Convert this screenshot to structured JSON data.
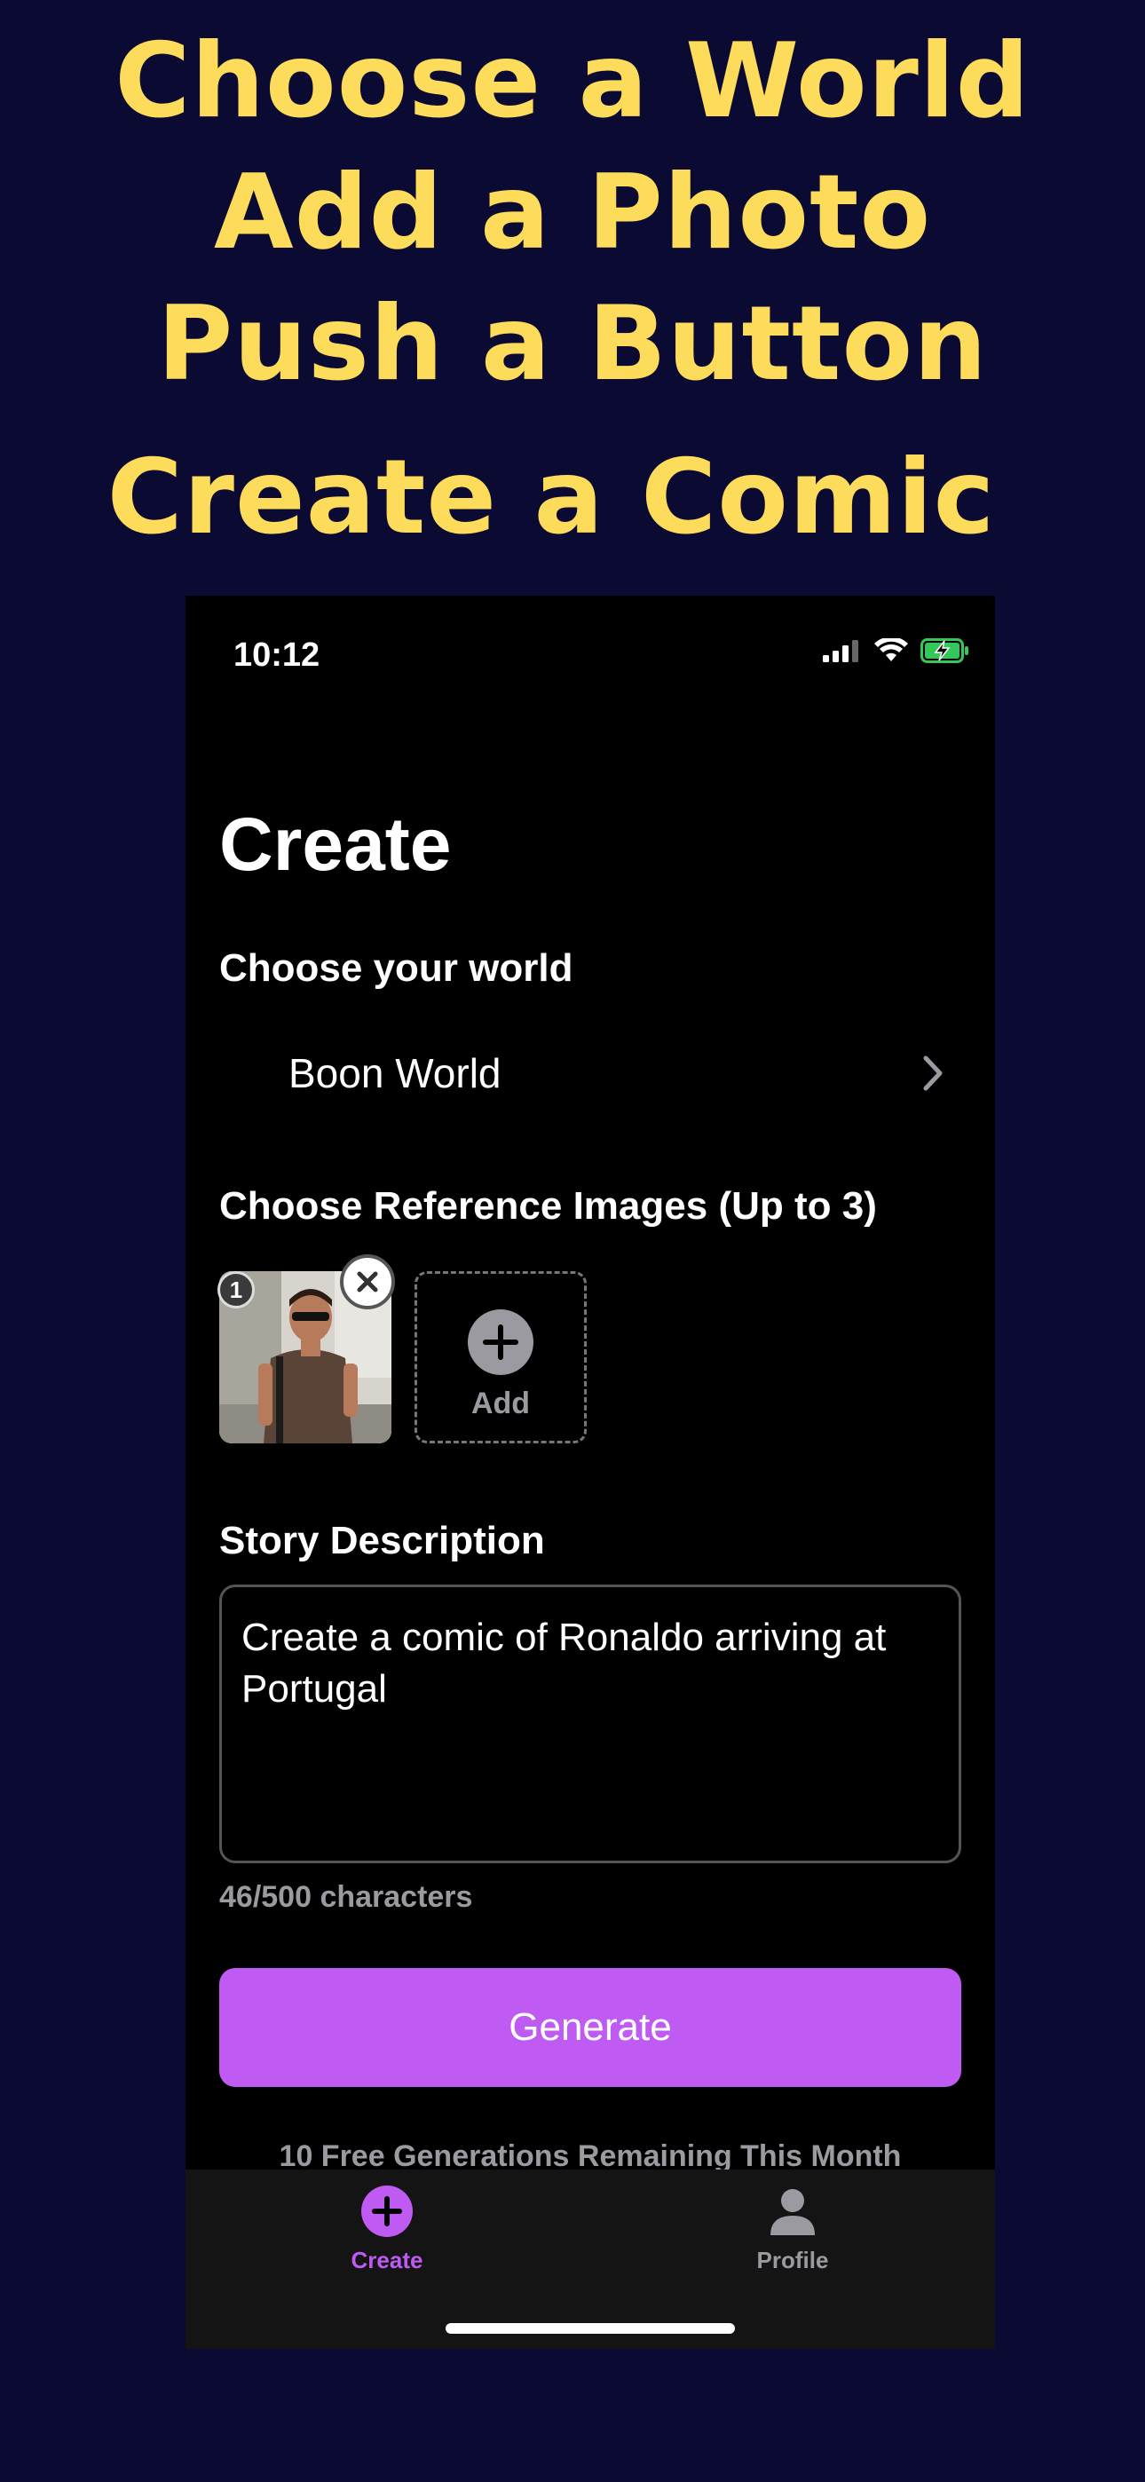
{
  "promo": {
    "line1": "Choose a World",
    "line2": "Add a Photo",
    "line3": "Push a Button",
    "line4": "Create a Comic"
  },
  "status_bar": {
    "time": "10:12",
    "icons": [
      "cellular-signal-icon",
      "wifi-icon",
      "battery-charging-icon"
    ]
  },
  "screen": {
    "title": "Create",
    "world_section_label": "Choose your world",
    "world_name": "Boon World",
    "reference_section_label": "Choose Reference Images (Up to 3)",
    "reference_images": [
      {
        "badge": "1"
      }
    ],
    "add_label": "Add",
    "story_label": "Story Description",
    "story_text": "Create a comic of Ronaldo arriving at Portugal",
    "char_count": "46/500 characters",
    "generate_label": "Generate",
    "remaining_text": "10 Free Generations Remaining This Month"
  },
  "tabbar": {
    "tabs": [
      {
        "label": "Create",
        "icon": "plus-circle-icon",
        "active": true
      },
      {
        "label": "Profile",
        "icon": "person-icon",
        "active": false
      }
    ]
  },
  "colors": {
    "background": "#0b0a33",
    "headline": "#fddb5b",
    "accent": "#bf5af2",
    "battery": "#34c759"
  }
}
